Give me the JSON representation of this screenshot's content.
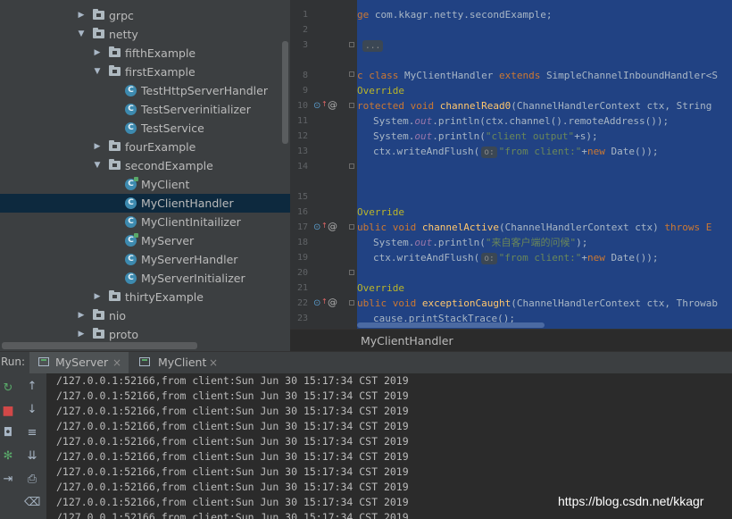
{
  "project_tree": {
    "items": [
      {
        "label": "grpc",
        "type": "folder",
        "expanded": false
      },
      {
        "label": "netty",
        "type": "folder",
        "expanded": true
      },
      {
        "label": "fifthExample",
        "type": "folder",
        "expanded": false
      },
      {
        "label": "firstExample",
        "type": "folder",
        "expanded": true
      },
      {
        "label": "TestHttpServerHandler",
        "type": "class"
      },
      {
        "label": "TestServerinitializer",
        "type": "class"
      },
      {
        "label": "TestService",
        "type": "class"
      },
      {
        "label": "fourExample",
        "type": "folder",
        "expanded": false
      },
      {
        "label": "secondExample",
        "type": "folder",
        "expanded": true
      },
      {
        "label": "MyClient",
        "type": "class",
        "runnable": true
      },
      {
        "label": "MyClientHandler",
        "type": "class",
        "selected": true
      },
      {
        "label": "MyClientInitailizer",
        "type": "class"
      },
      {
        "label": "MyServer",
        "type": "class",
        "runnable": true
      },
      {
        "label": "MyServerHandler",
        "type": "class"
      },
      {
        "label": "MyServerInitializer",
        "type": "class"
      },
      {
        "label": "thirtyExample",
        "type": "folder",
        "expanded": false
      },
      {
        "label": "nio",
        "type": "folder",
        "expanded": false
      },
      {
        "label": "proto",
        "type": "folder",
        "expanded": false
      }
    ],
    "class_icon_letter": "C"
  },
  "editor": {
    "line_numbers": [
      "1",
      "2",
      "3",
      "8",
      "9",
      "10",
      "11",
      "12",
      "13",
      "14",
      "15",
      "16",
      "17",
      "18",
      "19",
      "20",
      "21",
      "22",
      "23",
      "24"
    ],
    "code": {
      "l1a": "ge ",
      "l1b": "com.kkagr.netty.secondExample;",
      "l3a": "",
      "l3b": "...",
      "l8kw": "c class ",
      "l8a": "MyClientHandler ",
      "l8kw2": "extends ",
      "l8b": "SimpleChannelInboundHandler<S",
      "l9": "Override",
      "l10kw": "rotected void ",
      "l10m": "channelRead0",
      "l10a": "(ChannelHandlerContext ctx, String",
      "l11a": "System.",
      "l11f": "out",
      "l11b": ".println(ctx.channel().remoteAddress());",
      "l12a": "System.",
      "l12f": "out",
      "l12b": ".println(",
      "l12s": "\"client output\"",
      "l12c": "+s);",
      "l13a": "ctx.writeAndFlush(",
      "l13h": "o:",
      "l13s": "\"from client:\"",
      "l13b": "+",
      "l13kw": "new ",
      "l13c": "Date());",
      "l17": "Override",
      "l18kw": "ublic void ",
      "l18m": "channelActive",
      "l18a": "(ChannelHandlerContext ctx) ",
      "l18kw2": "throws E",
      "l19a": "System.",
      "l19f": "out",
      "l19b": ".println(",
      "l19s": "\"来自客户端的问候\"",
      "l19c": ");",
      "l20a": "ctx.writeAndFlush(",
      "l20h": "o:",
      "l20s": "\"from client:\"",
      "l20b": "+",
      "l20kw": "new ",
      "l20c": "Date());",
      "l22": "Override",
      "l23kw": "ublic void ",
      "l23m": "exceptionCaught",
      "l23a": "(ChannelHandlerContext ctx, Throwab",
      "l24": "cause.printStackTrace();"
    },
    "breadcrumb": "MyClientHandler"
  },
  "run_panel": {
    "label": "Run:",
    "tabs": [
      {
        "label": "MyServer",
        "active": true
      },
      {
        "label": "MyClient",
        "active": false
      }
    ],
    "close_glyph": "×",
    "output_lines": [
      "/127.0.0.1:52166,from client:Sun Jun 30 15:17:34 CST 2019",
      "/127.0.0.1:52166,from client:Sun Jun 30 15:17:34 CST 2019",
      "/127.0.0.1:52166,from client:Sun Jun 30 15:17:34 CST 2019",
      "/127.0.0.1:52166,from client:Sun Jun 30 15:17:34 CST 2019",
      "/127.0.0.1:52166,from client:Sun Jun 30 15:17:34 CST 2019",
      "/127.0.0.1:52166,from client:Sun Jun 30 15:17:34 CST 2019",
      "/127.0.0.1:52166,from client:Sun Jun 30 15:17:34 CST 2019",
      "/127.0.0.1:52166,from client:Sun Jun 30 15:17:34 CST 2019",
      "/127.0.0.1:52166,from client:Sun Jun 30 15:17:34 CST 2019",
      "/127.0.0.1:52166,from client:Sun Jun 30 15:17:34 CST 2019"
    ]
  },
  "watermark": "https://blog.csdn.net/kkagr",
  "colors": {
    "selection": "#214283",
    "keyword": "#cc7832",
    "string": "#6a8759",
    "method": "#ffc66d",
    "annotation": "#bbb529",
    "field": "#9876aa"
  }
}
